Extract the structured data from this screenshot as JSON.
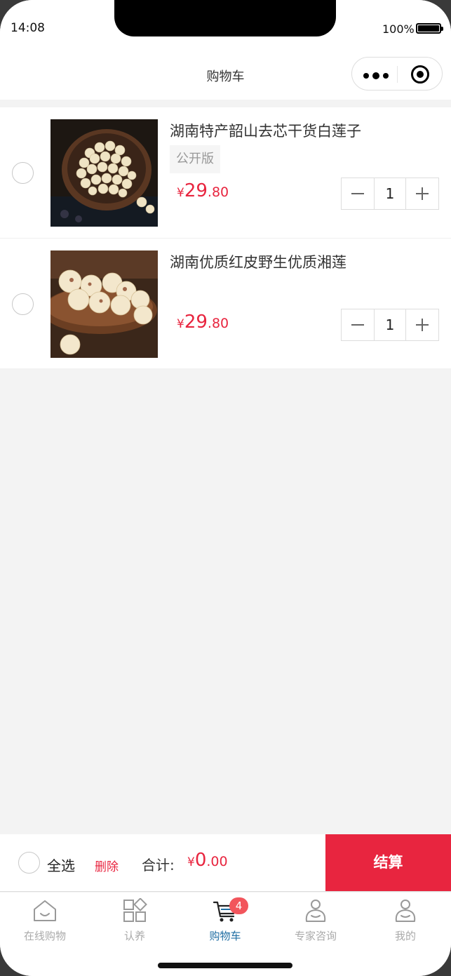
{
  "status_bar": {
    "time": "14:08",
    "battery": "100%"
  },
  "nav": {
    "title": "购物车",
    "more_icon": "more-dots-icon",
    "close_icon": "target-icon"
  },
  "cart": {
    "items": [
      {
        "title": "湖南特产韶山去芯干货白莲子",
        "spec": "公开版",
        "price_symbol": "¥",
        "price_int": "29",
        "price_dec": ".80",
        "qty": "1"
      },
      {
        "title": "湖南优质红皮野生优质湘莲",
        "spec": "",
        "price_symbol": "¥",
        "price_int": "29",
        "price_dec": ".80",
        "qty": "1"
      }
    ]
  },
  "checkout": {
    "select_all": "全选",
    "delete": "删除",
    "total_label": "合计:",
    "total_symbol": "¥",
    "total_int": "0",
    "total_dec": ".00",
    "submit": "结算"
  },
  "tabbar": {
    "tabs": [
      {
        "label": "在线购物",
        "icon": "home-icon"
      },
      {
        "label": "认养",
        "icon": "grid-icon"
      },
      {
        "label": "购物车",
        "icon": "cart-icon",
        "badge": "4",
        "active": true
      },
      {
        "label": "专家咨询",
        "icon": "expert-icon"
      },
      {
        "label": "我的",
        "icon": "user-icon"
      }
    ]
  },
  "colors": {
    "accent": "#e8253f",
    "active_tab": "#1f6ea3",
    "badge": "#f2555c"
  }
}
